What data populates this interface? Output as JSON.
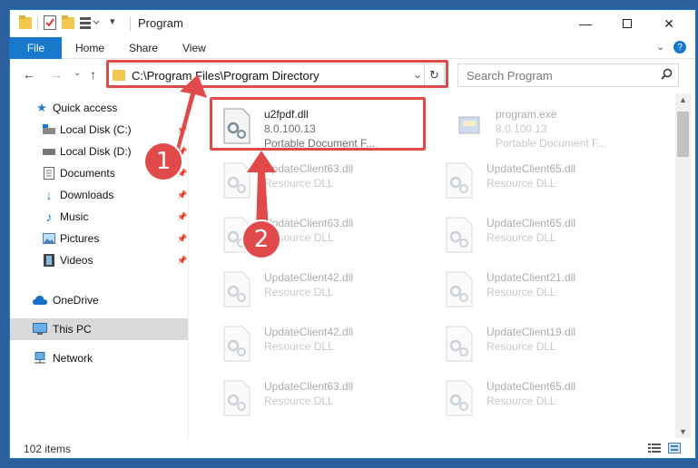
{
  "window": {
    "title": "Program"
  },
  "ribbon": {
    "file": "File",
    "tabs": [
      "Home",
      "Share",
      "View"
    ]
  },
  "address": {
    "path": "C:\\Program Files\\Program Directory"
  },
  "search": {
    "placeholder": "Search Program"
  },
  "sidebar": {
    "items": [
      {
        "label": "Quick access"
      },
      {
        "label": "Local Disk (C:)"
      },
      {
        "label": "Local Disk (D:)"
      },
      {
        "label": "Documents"
      },
      {
        "label": "Downloads"
      },
      {
        "label": "Music"
      },
      {
        "label": "Pictures"
      },
      {
        "label": "Videos"
      },
      {
        "label": "OneDrive"
      },
      {
        "label": "This PC"
      },
      {
        "label": "Network"
      }
    ]
  },
  "files": [
    {
      "name": "u2fpdf.dll",
      "sub1": "8.0.100.13",
      "sub2": "Portable Document F..."
    },
    {
      "name": "program.exe",
      "sub1": "8.0.100.13",
      "sub2": "Portable Document F..."
    },
    {
      "name": "UpdateClient63.dll",
      "sub1": "Resource DLL"
    },
    {
      "name": "UpdateClient65.dll",
      "sub1": "Resource DLL"
    },
    {
      "name": "UpdateClient63.dll",
      "sub1": "Resource DLL"
    },
    {
      "name": "UpdateClient65.dll",
      "sub1": "Resource DLL"
    },
    {
      "name": "UpdateClient42.dll",
      "sub1": "Resource DLL"
    },
    {
      "name": "UpdateClient21.dll",
      "sub1": "Resource DLL"
    },
    {
      "name": "UpdateClient42.dll",
      "sub1": "Resource DLL"
    },
    {
      "name": "UpdateClient19.dll",
      "sub1": "Resource DLL"
    },
    {
      "name": "UpdateClient63.dll",
      "sub1": "Resource DLL"
    },
    {
      "name": "UpdateClient65.dll",
      "sub1": "Resource DLL"
    }
  ],
  "status": {
    "count": "102 items"
  },
  "annotations": {
    "badge1": "1",
    "badge2": "2"
  },
  "colors": {
    "accent": "#1979ca",
    "annotation": "#e04a4a"
  }
}
